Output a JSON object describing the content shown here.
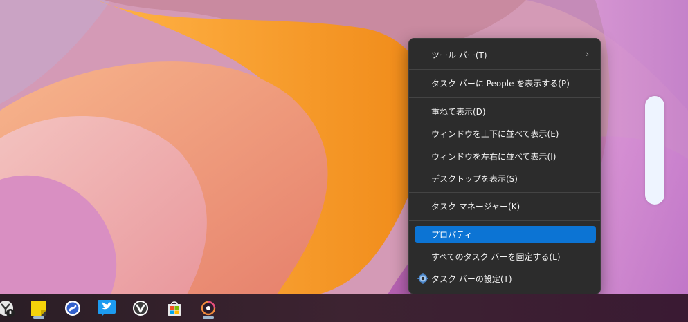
{
  "context_menu": {
    "items": [
      {
        "label": "ツール バー(T)",
        "has_submenu": true
      },
      {
        "label": "タスク バーに People を表示する(P)"
      },
      {
        "label": "重ねて表示(D)"
      },
      {
        "label": "ウィンドウを上下に並べて表示(E)"
      },
      {
        "label": "ウィンドウを左右に並べて表示(I)"
      },
      {
        "label": "デスクトップを表示(S)"
      },
      {
        "label": "タスク マネージャー(K)"
      },
      {
        "label": "プロパティ",
        "selected": true
      },
      {
        "label": "すべてのタスク バーを固定する(L)"
      },
      {
        "label": "タスク バーの設定(T)",
        "icon": "gear-icon"
      }
    ],
    "submenu_glyph": "›"
  },
  "taskbar": {
    "icons": [
      {
        "name": "assistant-icon",
        "running": false
      },
      {
        "name": "sticky-notes-icon",
        "running": true
      },
      {
        "name": "simplenote-icon",
        "running": false
      },
      {
        "name": "twitter-icon",
        "running": false
      },
      {
        "name": "vivaldi-icon",
        "running": false
      },
      {
        "name": "microsoft-store-icon",
        "running": false
      },
      {
        "name": "media-player-icon",
        "running": true
      }
    ]
  },
  "colors": {
    "menu_background": "#2c2c2c",
    "selection_accent": "#0c74d4",
    "taskbar_background": "#3d2331"
  }
}
